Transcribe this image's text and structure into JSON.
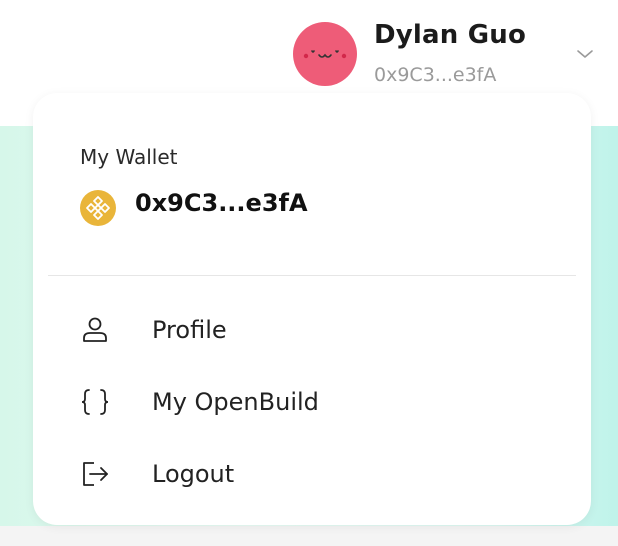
{
  "header": {
    "user_name": "Dylan Guo",
    "user_address": "0x9C3...e3fA",
    "avatar_color": "#ee5c78",
    "chevron_icon": "chevron-down-icon"
  },
  "dropdown": {
    "wallet_label": "My Wallet",
    "wallet_address": "0x9C3...e3fA",
    "wallet_icon": "bnb-coin-icon",
    "coin_color": "#e9b53a",
    "menu": [
      {
        "label": "Profile",
        "icon": "user-icon"
      },
      {
        "label": "My OpenBuild",
        "icon": "braces-icon"
      },
      {
        "label": "Logout",
        "icon": "logout-icon"
      }
    ]
  }
}
